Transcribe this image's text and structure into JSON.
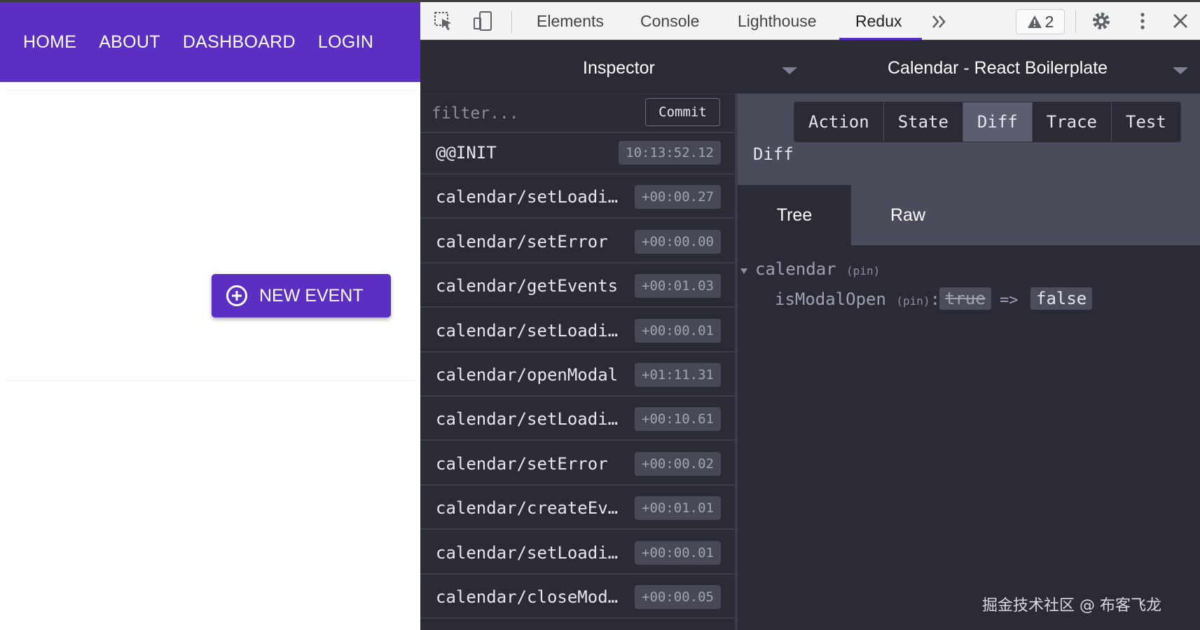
{
  "app": {
    "nav": [
      "HOME",
      "ABOUT",
      "DASHBOARD",
      "LOGIN"
    ],
    "new_event_label": "NEW EVENT"
  },
  "devtools": {
    "tabs": [
      "Elements",
      "Console",
      "Lighthouse",
      "Redux"
    ],
    "active_tab": "Redux",
    "warning_count": "2",
    "inspector_label": "Inspector",
    "instance_label": "Calendar - React Boilerplate"
  },
  "redux": {
    "filter_placeholder": "filter...",
    "commit_label": "Commit",
    "actions": [
      {
        "name": "@@INIT",
        "time": "10:13:52.12"
      },
      {
        "name": "calendar/setLoadi…",
        "time": "+00:00.27"
      },
      {
        "name": "calendar/setError",
        "time": "+00:00.00"
      },
      {
        "name": "calendar/getEvents",
        "time": "+00:01.03"
      },
      {
        "name": "calendar/setLoadi…",
        "time": "+00:00.01"
      },
      {
        "name": "calendar/openModal",
        "time": "+01:11.31"
      },
      {
        "name": "calendar/setLoadi…",
        "time": "+00:10.61"
      },
      {
        "name": "calendar/setError",
        "time": "+00:00.02"
      },
      {
        "name": "calendar/createEv…",
        "time": "+00:01.01"
      },
      {
        "name": "calendar/setLoadi…",
        "time": "+00:00.01"
      },
      {
        "name": "calendar/closeMod…",
        "time": "+00:00.05"
      }
    ],
    "monitor_tabs": [
      "Action",
      "State",
      "Diff",
      "Trace",
      "Test"
    ],
    "active_monitor_tab": "Diff",
    "section_title": "Diff",
    "view_tabs": [
      "Tree",
      "Raw"
    ],
    "active_view_tab": "Tree",
    "diff": {
      "root_key": "calendar",
      "root_pin": "(pin)",
      "key": "isModalOpen",
      "key_pin": "(pin)",
      "old_value": "true",
      "arrow": "=>",
      "new_value": "false"
    }
  },
  "watermark": "掘金技术社区 @ 布客飞龙"
}
